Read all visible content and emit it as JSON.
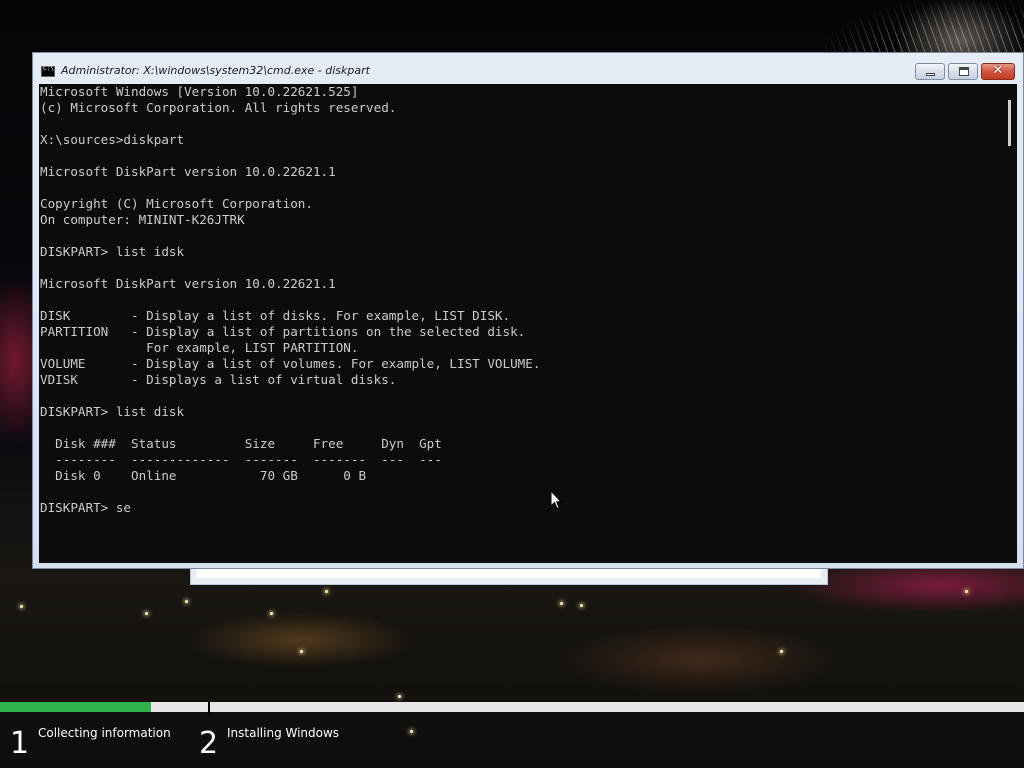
{
  "window": {
    "title": "Administrator: X:\\windows\\system32\\cmd.exe - diskpart",
    "close_glyph": "✕"
  },
  "console": {
    "lines": [
      "Microsoft Windows [Version 10.0.22621.525]",
      "(c) Microsoft Corporation. All rights reserved.",
      "",
      "X:\\sources>diskpart",
      "",
      "Microsoft DiskPart version 10.0.22621.1",
      "",
      "Copyright (C) Microsoft Corporation.",
      "On computer: MININT-K26JTRK",
      "",
      "DISKPART> list idsk",
      "",
      "Microsoft DiskPart version 10.0.22621.1",
      "",
      "DISK        - Display a list of disks. For example, LIST DISK.",
      "PARTITION   - Display a list of partitions on the selected disk.",
      "              For example, LIST PARTITION.",
      "VOLUME      - Display a list of volumes. For example, LIST VOLUME.",
      "VDISK       - Displays a list of virtual disks.",
      "",
      "DISKPART> list disk",
      "",
      "  Disk ###  Status         Size     Free     Dyn  Gpt",
      "  --------  -------------  -------  -------  ---  ---",
      "  Disk 0    Online           70 GB      0 B",
      "",
      "DISKPART> se"
    ]
  },
  "setup": {
    "progress_fraction": 0.147,
    "steps": [
      {
        "number": "1",
        "label": "Collecting information"
      },
      {
        "number": "2",
        "label": "Installing Windows"
      }
    ]
  },
  "icons": {
    "title_icon": "cmd-icon",
    "minimize": "minimize-icon",
    "maximize": "maximize-icon",
    "close": "close-icon",
    "pointer": "mouse-pointer-icon"
  }
}
